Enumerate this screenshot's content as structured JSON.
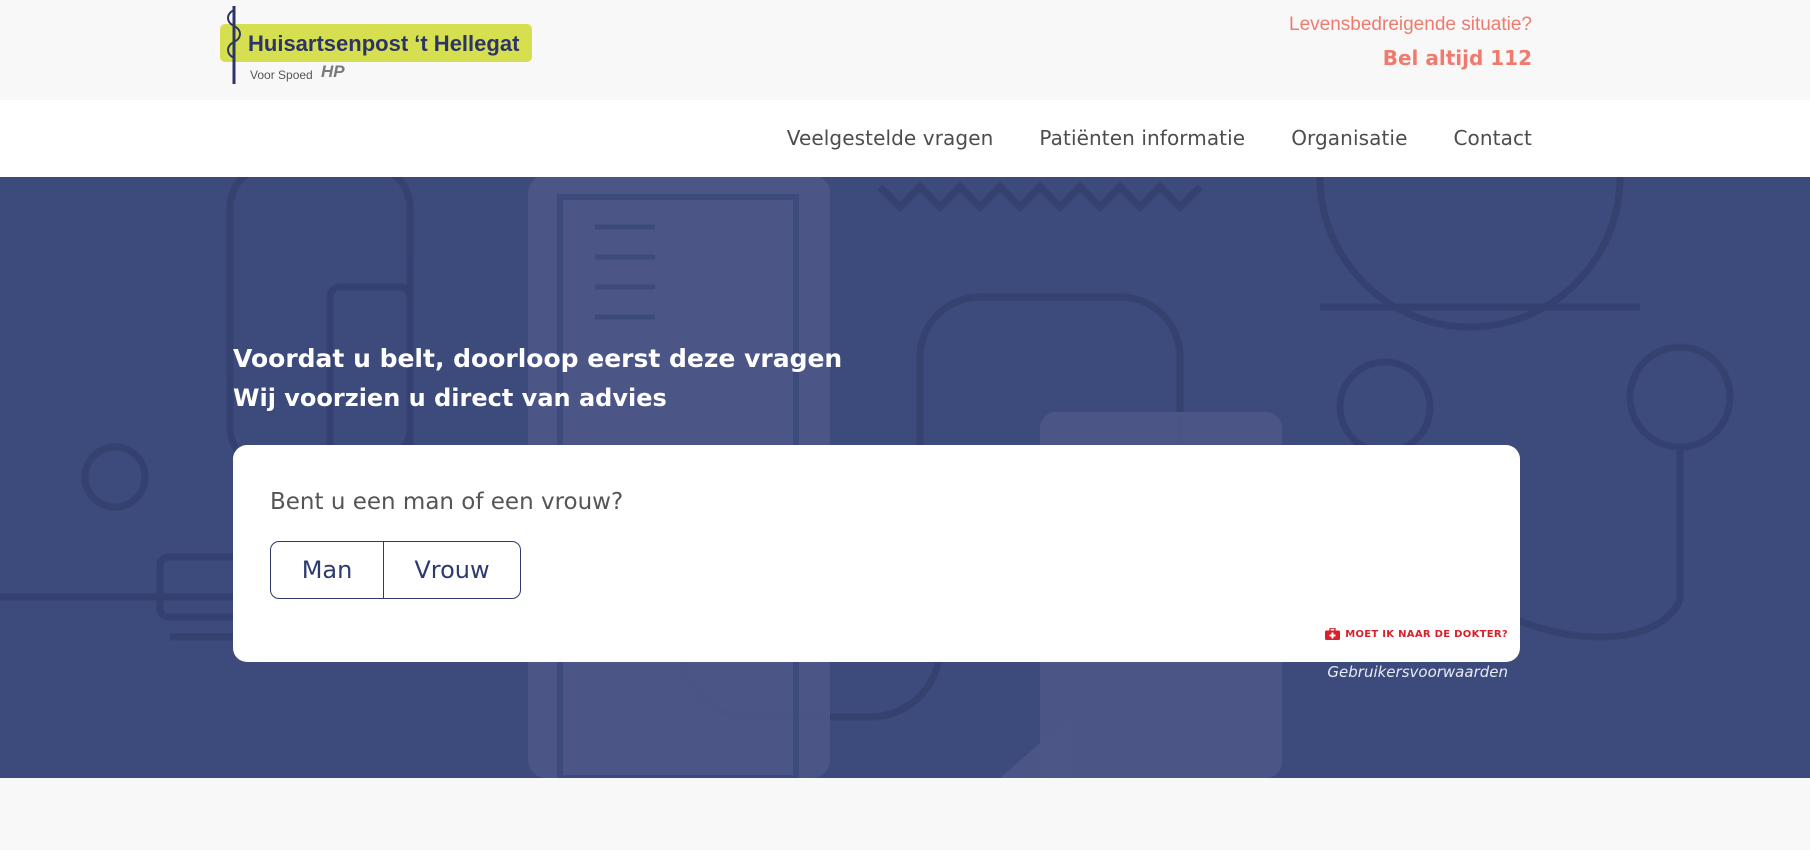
{
  "header": {
    "logo": {
      "name": "Huisartsenpost ‘t Hellegat",
      "tagline": "Voor Spoed",
      "mark": "HP"
    },
    "emergency": {
      "question": "Levensbedreigende situatie?",
      "call": "Bel altijd 112",
      "color": "#ee7b6e"
    }
  },
  "nav": {
    "items": [
      {
        "label": "Veelgestelde vragen"
      },
      {
        "label": "Patiënten informatie"
      },
      {
        "label": "Organisatie"
      },
      {
        "label": "Contact"
      }
    ]
  },
  "hero": {
    "background_color": "#3c4a7c",
    "title": "Voordat u belt, doorloop eerst deze vragen",
    "subtitle": "Wij voorzien u direct van advies"
  },
  "questionnaire": {
    "question": "Bent u een man of een vrouw?",
    "options": [
      {
        "label": "Man"
      },
      {
        "label": "Vrouw"
      }
    ],
    "doctor_link": {
      "icon": "first-aid-kit-icon",
      "label": "MOET IK NAAR DE DOKTER?",
      "color": "#d81f2a"
    }
  },
  "footer": {
    "terms": "Gebruikersvoorwaarden"
  }
}
